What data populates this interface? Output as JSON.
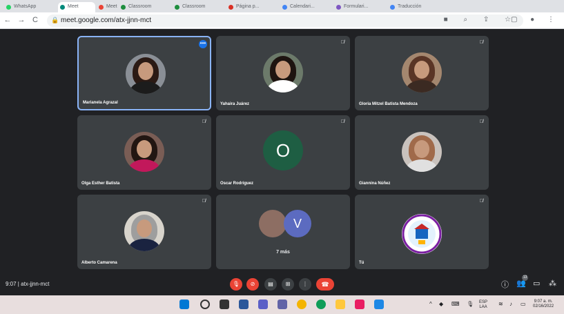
{
  "browser": {
    "tabs": [
      {
        "label": "WhatsApp",
        "color": "#25d366"
      },
      {
        "label": "Meet",
        "color": "#00897b"
      },
      {
        "label": "Meet",
        "color": "#ea4335"
      },
      {
        "label": "Classroom",
        "color": "#1e8e3e"
      },
      {
        "label": "Classroom",
        "color": "#1e8e3e"
      },
      {
        "label": "Página p...",
        "color": "#d93025"
      },
      {
        "label": "Calendari...",
        "color": "#4285f4"
      },
      {
        "label": "Formulari...",
        "color": "#7e57c2"
      },
      {
        "label": "Traducción",
        "color": "#4285f4"
      }
    ],
    "url": "meet.google.com/atx-jjnn-mct"
  },
  "participants": [
    {
      "name": "Marianela Agrazal",
      "type": "photo",
      "hair": "#2b1a14",
      "shirt": "#1c1c1c"
    },
    {
      "name": "Yahaira Juárez",
      "type": "photo",
      "hair": "#1e1410",
      "shirt": "#ffffff"
    },
    {
      "name": "Gloria Mitzel Batista Mendoza",
      "type": "photo",
      "hair": "#5a3526",
      "shirt": "#3b2a22"
    },
    {
      "name": "Olga Esther Batista",
      "type": "photo",
      "hair": "#221612",
      "shirt": "#c2185b"
    },
    {
      "name": "Oscar Rodríguez",
      "type": "letter",
      "letter": "O",
      "color": "#1e5e43"
    },
    {
      "name": "Giannina Núñez",
      "type": "photo",
      "hair": "#a06a4a",
      "shirt": "#e0e0e0"
    },
    {
      "name": "Alberto Camarena",
      "type": "photo",
      "hair": "#9e9e9e",
      "shirt": "#1a2340"
    },
    {
      "name": "",
      "type": "more",
      "letter": "V",
      "label": "7 más"
    },
    {
      "name": "Tú",
      "type": "logo"
    }
  ],
  "bottom": {
    "meeting_code": "9:07 | atx-jjnn-mct",
    "people_badge": "13"
  },
  "taskbar": {
    "lang": "ESP",
    "region": "LAA",
    "time": "9:07 a. m.",
    "date": "02/16/2022"
  },
  "colors": {
    "meet_bg": "#202124",
    "tile_bg": "#3c4043",
    "danger": "#ea4335",
    "accent": "#8ab4f8"
  }
}
